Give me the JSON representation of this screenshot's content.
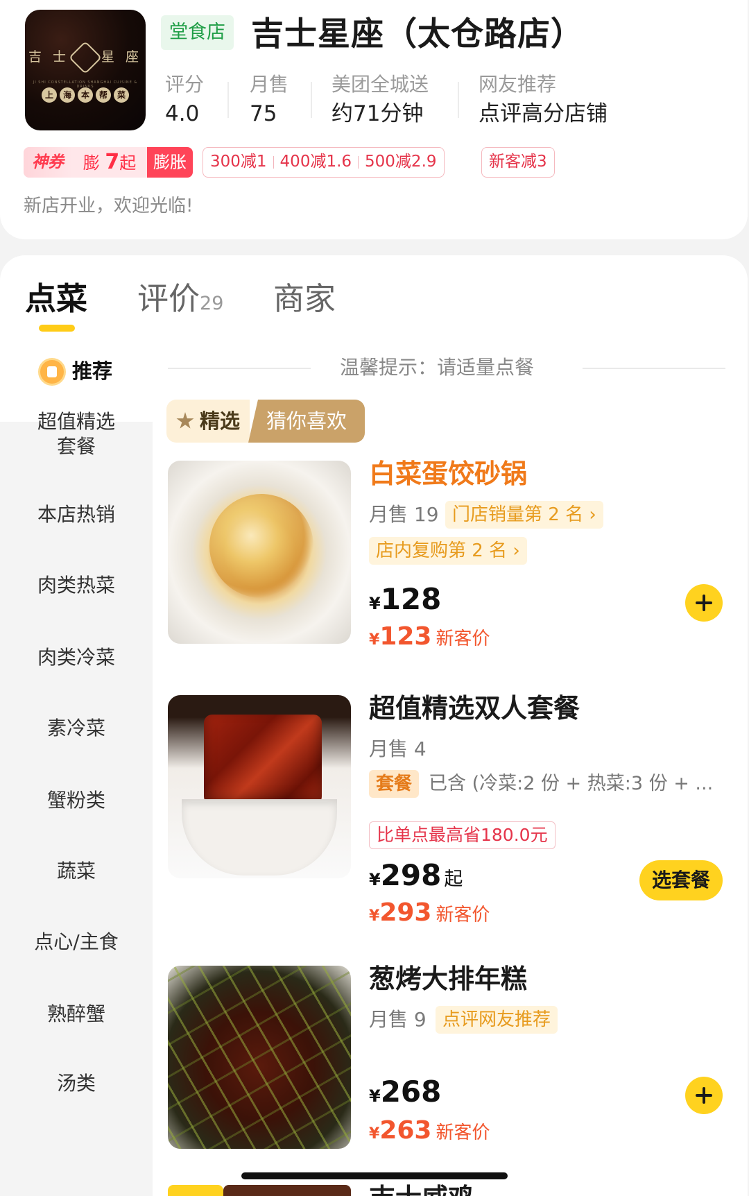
{
  "store": {
    "logo_text_left": "吉 士",
    "logo_text_right": "星 座",
    "logo_subtitle": "JI SHI CONSTELLATION SHANGHAI CUISINE & DRINKS",
    "logo_seals": [
      "上",
      "海",
      "本",
      "帮",
      "菜"
    ],
    "type_tag": "堂食店",
    "name": "吉士星座（太仓路店）",
    "stats": [
      {
        "label": "评分",
        "value": "4.0"
      },
      {
        "label": "月售",
        "value": "75"
      },
      {
        "label": "美团全城送",
        "value": "约71分钟"
      },
      {
        "label": "网友推荐",
        "value": "点评高分店铺"
      }
    ],
    "promo": {
      "shenquan": "神券",
      "expand_prefix": "膨",
      "expand_num": "7",
      "expand_suffix": "起",
      "expand_btn": "膨胀",
      "discounts": [
        "300减1",
        "400减1.6",
        "500减2.9"
      ],
      "new_customer": "新客减3"
    },
    "notice": "新店开业，欢迎光临!"
  },
  "tabs": {
    "order": "点菜",
    "reviews": "评价",
    "reviews_count": "29",
    "merchant": "商家"
  },
  "sidebar": {
    "recommended": "推荐",
    "items": [
      "超值精选",
      "套餐",
      "本店热销",
      "肉类热菜",
      "肉类冷菜",
      "素冷菜",
      "蟹粉类",
      "蔬菜",
      "点心/主食",
      "熟醉蟹",
      "汤类"
    ]
  },
  "content": {
    "tip": "温馨提示：请适量点餐",
    "featured_left": "精选",
    "featured_right": "猜你喜欢",
    "dishes": [
      {
        "name": "白菜蛋饺砂锅",
        "monthly": "月售 19",
        "tags": [
          "门店销量第 2 名 ›",
          "店内复购第 2 名 ›"
        ],
        "yen": "¥",
        "price": "128",
        "new_price": "123",
        "new_label": "新客价"
      },
      {
        "name": "超值精选双人套餐",
        "monthly": "月售 4",
        "set_tag": "套餐",
        "contains": "已含 (冷菜:2 份 + 热菜:3 份 + ...",
        "save_tag": "比单点最高省180.0元",
        "yen": "¥",
        "price": "298",
        "price_suffix": "起",
        "new_price": "293",
        "new_label": "新客价",
        "choose_label": "选套餐"
      },
      {
        "name": "葱烤大排年糕",
        "monthly": "月售 9",
        "tags": [
          "点评网友推荐"
        ],
        "yen": "¥",
        "price": "268",
        "new_price": "263",
        "new_label": "新客价"
      }
    ],
    "next_dish_partial": "吉士威鸡"
  },
  "colors": {
    "accent_yellow": "#ffd21f",
    "price_orange": "#f2562e",
    "tag_green": "#1f9e46",
    "promo_red": "#e5344a"
  }
}
